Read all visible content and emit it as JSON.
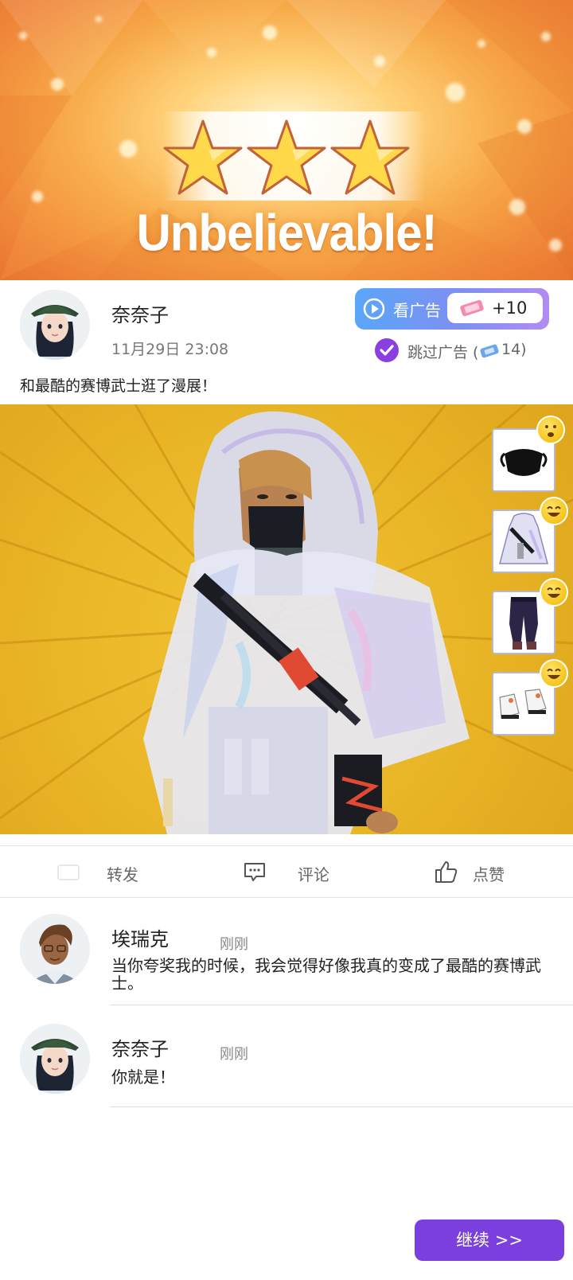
{
  "result": {
    "headline": "Unbelievable!",
    "stars_earned": 3,
    "stars_total": 3
  },
  "post": {
    "author": "奈奈子",
    "timestamp": "11月29日 23:08",
    "text": "和最酷的赛博武士逛了漫展！"
  },
  "ad": {
    "watch_label": "看广告",
    "reward": "+10",
    "skip_label": "跳过广告 (",
    "skip_count": "14)"
  },
  "actions": {
    "share": "转发",
    "comment": "评论",
    "like": "点赞"
  },
  "comments": [
    {
      "author": "埃瑞克",
      "time": "刚刚",
      "text": "当你夸奖我的时候，我会觉得好像我真的变成了最酷的赛博武士。"
    },
    {
      "author": "奈奈子",
      "time": "刚刚",
      "text": "你就是！"
    }
  ],
  "outfit_items": [
    {
      "icon": "face-mask-icon",
      "reaction": "surprised-emoji"
    },
    {
      "icon": "holographic-coat-icon",
      "reaction": "grinning-emoji"
    },
    {
      "icon": "cargo-pants-icon",
      "reaction": "grinning-emoji"
    },
    {
      "icon": "sneakers-icon",
      "reaction": "grinning-emoji"
    }
  ],
  "continue_label": "继续 >>",
  "colors": {
    "accent_purple": "#7b3fe0",
    "ad_gradient_start": "#5aa6f8",
    "ad_gradient_end": "#b28cf2",
    "scene_yellow": "#e8b526"
  }
}
